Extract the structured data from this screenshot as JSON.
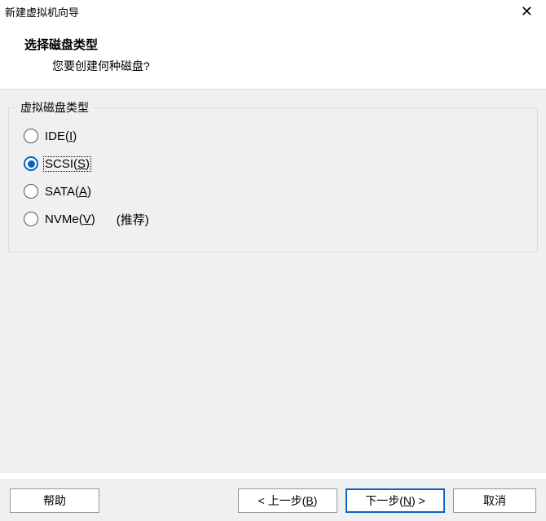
{
  "titlebar": {
    "title": "新建虚拟机向导",
    "close": "✕"
  },
  "header": {
    "title": "选择磁盘类型",
    "subtitle": "您要创建何种磁盘?"
  },
  "group": {
    "title": "虚拟磁盘类型",
    "options": [
      {
        "label": "IDE",
        "mnemonic": "I",
        "selected": false,
        "note": ""
      },
      {
        "label": "SCSI",
        "mnemonic": "S",
        "selected": true,
        "note": ""
      },
      {
        "label": "SATA",
        "mnemonic": "A",
        "selected": false,
        "note": ""
      },
      {
        "label": "NVMe",
        "mnemonic": "V",
        "selected": false,
        "note": "(推荐)"
      }
    ]
  },
  "footer": {
    "help": "帮助",
    "back_prefix": "< 上一步(",
    "back_mnemonic": "B",
    "back_suffix": ")",
    "next_prefix": "下一步(",
    "next_mnemonic": "N",
    "next_suffix": ") >",
    "cancel": "取消"
  }
}
